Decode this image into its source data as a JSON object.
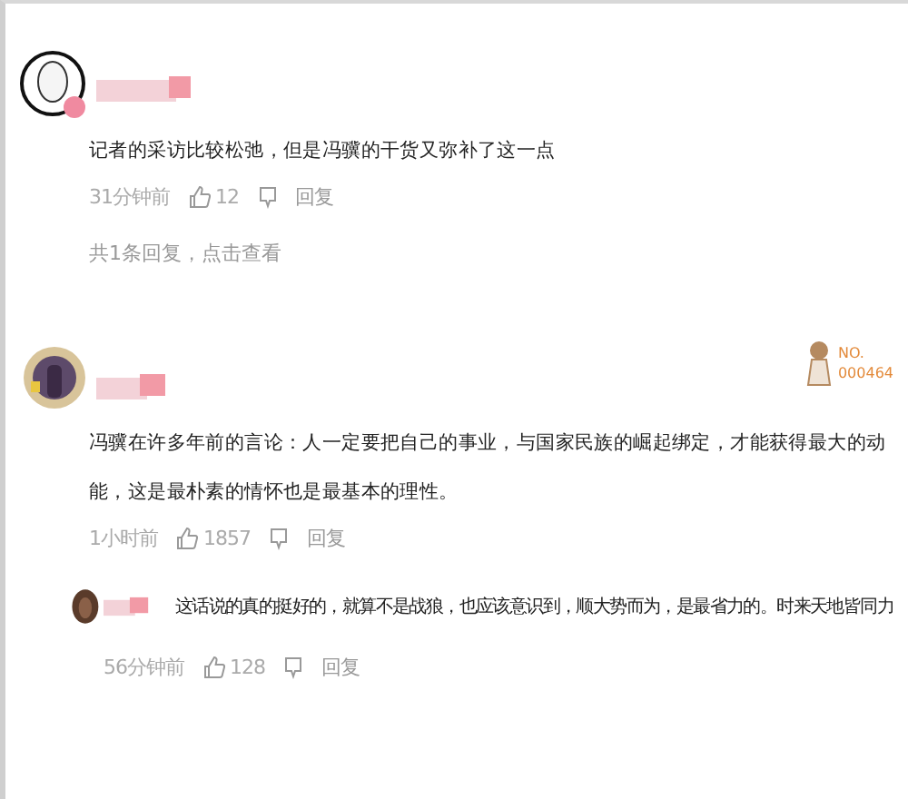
{
  "comments": [
    {
      "text": "记者的采访比较松弛，但是冯骥的干货又弥补了这一点",
      "time": "31分钟前",
      "likes": "12",
      "reply_label": "回复",
      "replies_link": "共1条回复，点击查看"
    },
    {
      "text": "冯骥在许多年前的言论：人一定要把自己的事业，与国家民族的崛起绑定，才能获得最大的动能，这是最朴素的情怀也是最基本的理性。",
      "time": "1小时前",
      "likes": "1857",
      "reply_label": "回复",
      "badge": {
        "line1": "NO.",
        "line2": "000464"
      },
      "replies": [
        {
          "text": "这话说的真的挺好的，就算不是战狼，也应该意识到，顺大势而为，是最省力的。时来天地皆同力",
          "time": "56分钟前",
          "likes": "128",
          "reply_label": "回复"
        }
      ]
    }
  ]
}
